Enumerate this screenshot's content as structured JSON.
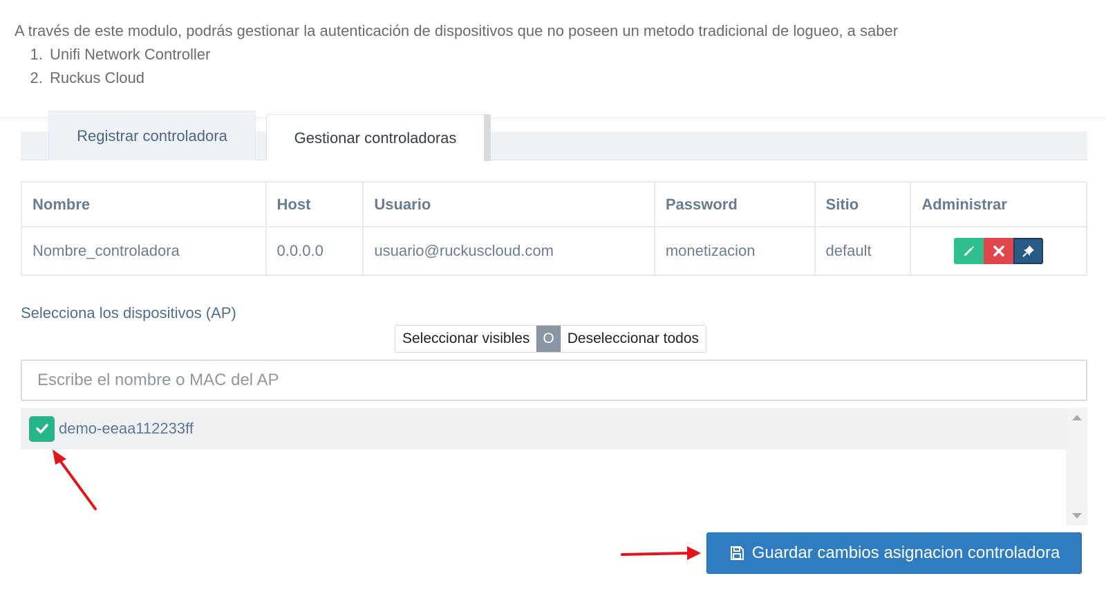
{
  "intro": {
    "text": "A través de este modulo, podrás gestionar la autenticación de dispositivos que no poseen un metodo tradicional de logueo, a saber",
    "items": [
      "Unifi Network Controller",
      "Ruckus Cloud"
    ]
  },
  "tabs": [
    {
      "label": "Registrar controladora"
    },
    {
      "label": "Gestionar controladoras"
    }
  ],
  "table": {
    "headers": [
      "Nombre",
      "Host",
      "Usuario",
      "Password",
      "Sitio",
      "Administrar"
    ],
    "rows": [
      [
        "Nombre_controladora",
        "0.0.0.0",
        "usuario@ruckuscloud.com",
        "monetizacion",
        "default"
      ]
    ],
    "action_icons": [
      "pencil-icon",
      "close-icon",
      "pin-icon"
    ]
  },
  "selection": {
    "label": "Selecciona los dispositivos (AP)",
    "select_visible": "Seleccionar visibles",
    "toggle_mid": "O",
    "deselect_all": "Deseleccionar todos"
  },
  "search": {
    "placeholder": "Escribe el nombre o MAC del AP",
    "value": ""
  },
  "devices": [
    {
      "label": "demo-eeaa112233ff",
      "checked": true
    }
  ],
  "save_button": {
    "label": "Guardar cambios asignacion controladora",
    "icon": "floppy-disk-icon"
  },
  "colors": {
    "accent": "#2f7cc1",
    "success": "#2fbf8e",
    "danger": "#e0474c",
    "annotation": "#e0161b"
  }
}
